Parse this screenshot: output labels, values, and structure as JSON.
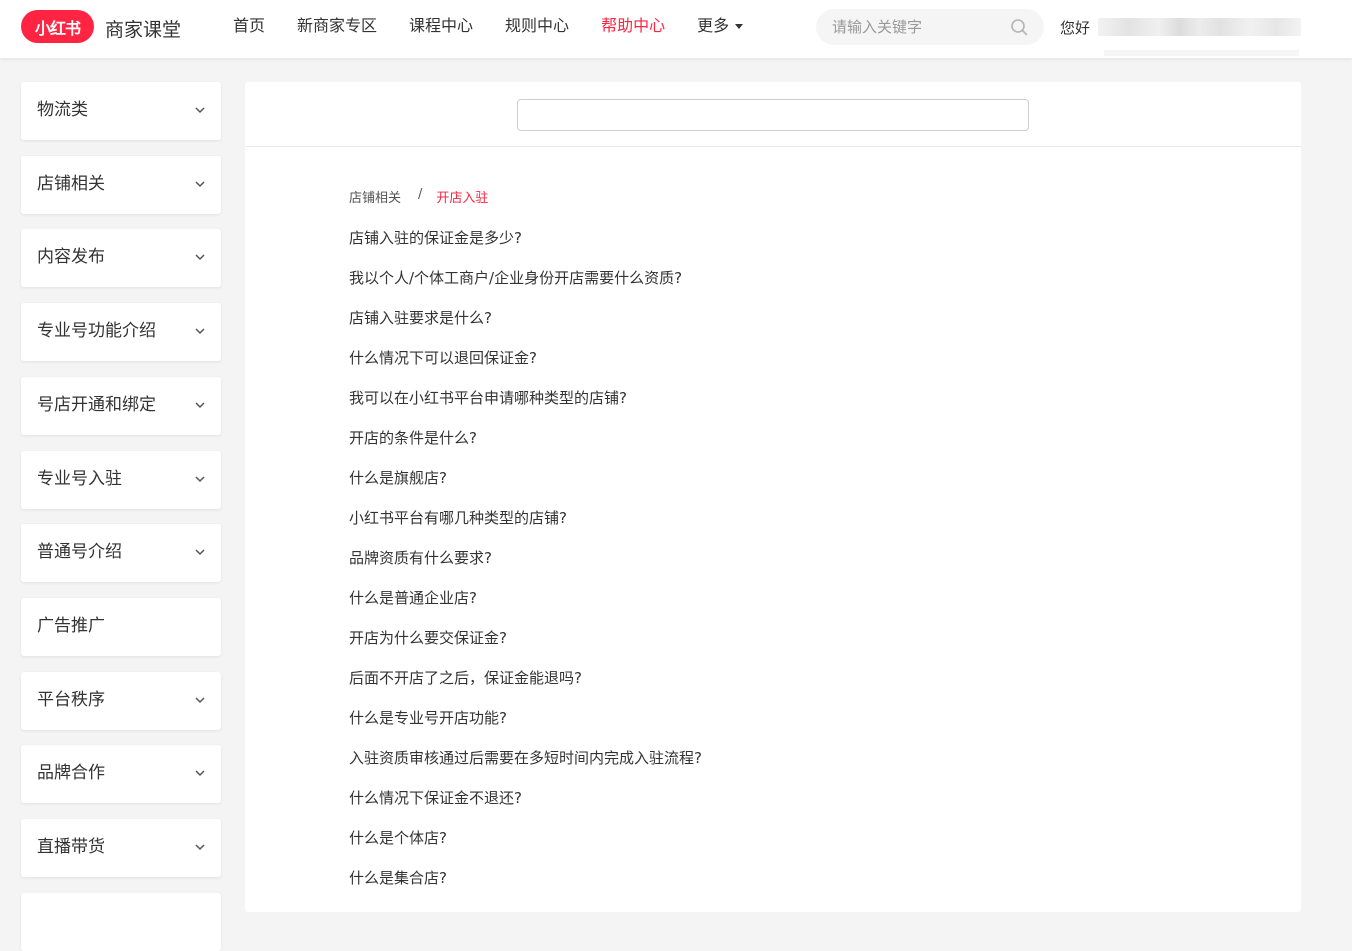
{
  "header": {
    "logo_text": "小红书",
    "brand_name": "商家课堂",
    "nav": [
      {
        "label": "首页",
        "active": false
      },
      {
        "label": "新商家专区",
        "active": false
      },
      {
        "label": "课程中心",
        "active": false
      },
      {
        "label": "规则中心",
        "active": false
      },
      {
        "label": "帮助中心",
        "active": true
      }
    ],
    "more_label": "更多",
    "search_placeholder": "请输入关键字",
    "greeting": "您好"
  },
  "sidebar": {
    "items": [
      {
        "label": "物流类",
        "has_chevron": true
      },
      {
        "label": "店铺相关",
        "has_chevron": true
      },
      {
        "label": "内容发布",
        "has_chevron": true
      },
      {
        "label": "专业号功能介绍",
        "has_chevron": true
      },
      {
        "label": "号店开通和绑定",
        "has_chevron": true
      },
      {
        "label": "专业号入驻",
        "has_chevron": true
      },
      {
        "label": "普通号介绍",
        "has_chevron": true
      },
      {
        "label": "广告推广",
        "has_chevron": false
      },
      {
        "label": "平台秩序",
        "has_chevron": true
      },
      {
        "label": "品牌合作",
        "has_chevron": true
      },
      {
        "label": "直播带货",
        "has_chevron": true
      }
    ]
  },
  "main": {
    "search_value": "",
    "breadcrumb": {
      "parent": "店铺相关",
      "separator": "/",
      "current": "开店入驻"
    },
    "questions": [
      "店铺入驻的保证金是多少?",
      "我以个人/个体工商户/企业身份开店需要什么资质?",
      "店铺入驻要求是什么?",
      "什么情况下可以退回保证金?",
      "我可以在小红书平台申请哪种类型的店铺?",
      "开店的条件是什么?",
      "什么是旗舰店?",
      "小红书平台有哪几种类型的店铺?",
      "品牌资质有什么要求?",
      "什么是普通企业店?",
      "开店为什么要交保证金?",
      "后面不开店了之后，保证金能退吗?",
      "什么是专业号开店功能?",
      "入驻资质审核通过后需要在多短时间内完成入驻流程?",
      "什么情况下保证金不退还?",
      "什么是个体店?",
      "什么是集合店?"
    ]
  },
  "colors": {
    "brand": "#ff2442",
    "page_bg": "#f4f4f4",
    "card_bg": "#ffffff"
  },
  "icons": {
    "search": "search-icon",
    "chevron": "chevron-down-icon",
    "caret": "caret-down-icon"
  }
}
